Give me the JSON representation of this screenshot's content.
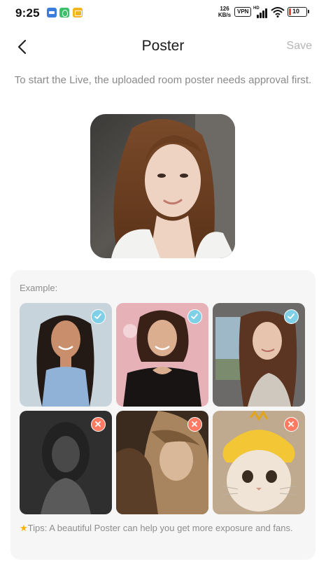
{
  "status_bar": {
    "time": "9:25",
    "net_speed_value": "126",
    "net_speed_unit": "KB/s",
    "vpn_label": "VPN",
    "signal_label": "HD",
    "battery_level": "10",
    "app_icons": [
      "messages-icon",
      "security-icon",
      "mail-icon"
    ]
  },
  "header": {
    "title": "Poster",
    "save_label": "Save"
  },
  "instruction": "To start the Live, the uploaded room poster needs approval first.",
  "example": {
    "label": "Example:",
    "good_examples": [
      {
        "name": "example-good-1",
        "status": "approved"
      },
      {
        "name": "example-good-2",
        "status": "approved"
      },
      {
        "name": "example-good-3",
        "status": "approved"
      }
    ],
    "bad_examples": [
      {
        "name": "example-bad-1",
        "status": "rejected"
      },
      {
        "name": "example-bad-2",
        "status": "rejected"
      },
      {
        "name": "example-bad-3",
        "status": "rejected"
      }
    ],
    "tips": "Tips: A beautiful Poster can help you get more exposure and fans."
  },
  "colors": {
    "approved_badge": "#7fd0e6",
    "rejected_badge": "#ff7a62",
    "tip_star": "#f5b400",
    "battery_low": "#e0453a"
  }
}
